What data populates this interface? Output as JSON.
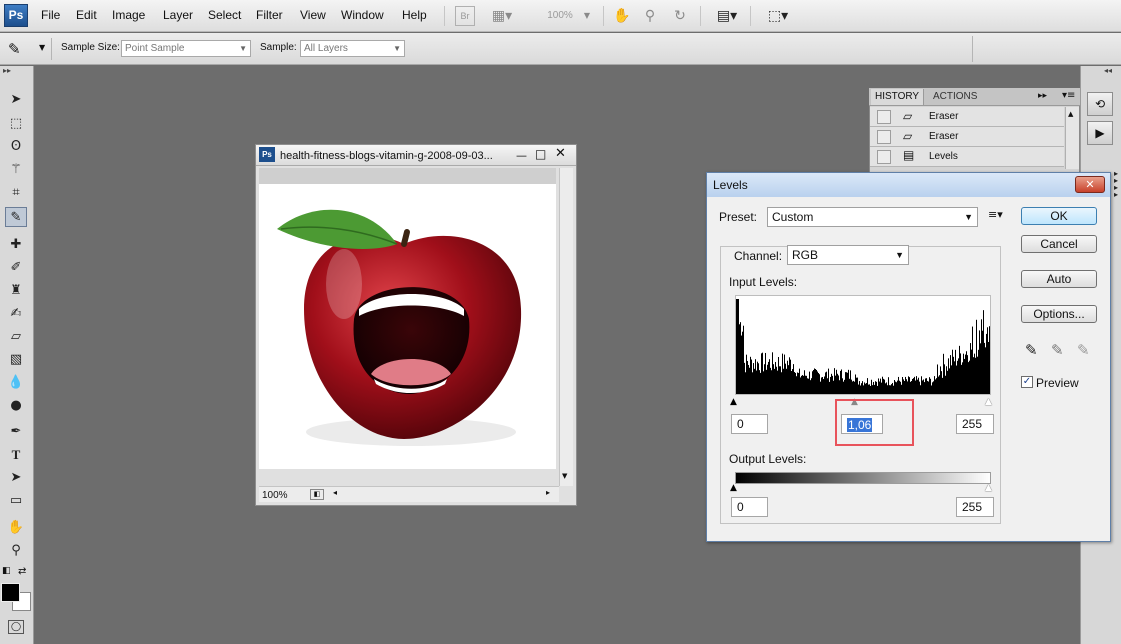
{
  "app": {
    "logo_text": "Ps",
    "menu": [
      "File",
      "Edit",
      "Image",
      "Layer",
      "Select",
      "Filter",
      "View",
      "Window",
      "Help"
    ],
    "bridge_label": "Br",
    "zoom_display": "100%"
  },
  "options_bar": {
    "sample_size_label": "Sample Size:",
    "sample_size_value": "Point Sample",
    "sample_label": "Sample:",
    "sample_value": "All Layers"
  },
  "tools": [
    "move-icon",
    "marquee-icon",
    "lasso-icon",
    "magic-wand-icon",
    "crop-icon",
    "eyedropper-icon",
    "healing-brush-icon",
    "brush-icon",
    "clone-stamp-icon",
    "history-brush-icon",
    "eraser-icon",
    "gradient-icon",
    "blur-icon",
    "dodge-icon",
    "pen-icon",
    "type-icon",
    "path-selection-icon",
    "shape-icon",
    "hand-icon",
    "zoom-icon"
  ],
  "colors": {
    "foreground": "#000000",
    "background": "#ffffff"
  },
  "history_panel": {
    "tabs": [
      "HISTORY",
      "ACTIONS"
    ],
    "items": [
      {
        "label": "Eraser",
        "icon": "eraser-icon"
      },
      {
        "label": "Eraser",
        "icon": "eraser-icon"
      },
      {
        "label": "Levels",
        "icon": "levels-icon"
      }
    ]
  },
  "document": {
    "title": "health-fitness-blogs-vitamin-g-2008-09-03...",
    "zoom": "100%",
    "image_subject": "red-apple-with-mouth"
  },
  "levels_dialog": {
    "title": "Levels",
    "preset_label": "Preset:",
    "preset_value": "Custom",
    "channel_label": "Channel:",
    "channel_value": "RGB",
    "input_levels_label": "Input Levels:",
    "input_black": "0",
    "input_mid": "1,06",
    "input_white": "255",
    "output_levels_label": "Output Levels:",
    "output_black": "0",
    "output_white": "255",
    "buttons": {
      "ok": "OK",
      "cancel": "Cancel",
      "auto": "Auto",
      "options": "Options..."
    },
    "preview_label": "Preview",
    "preview_checked": true
  }
}
